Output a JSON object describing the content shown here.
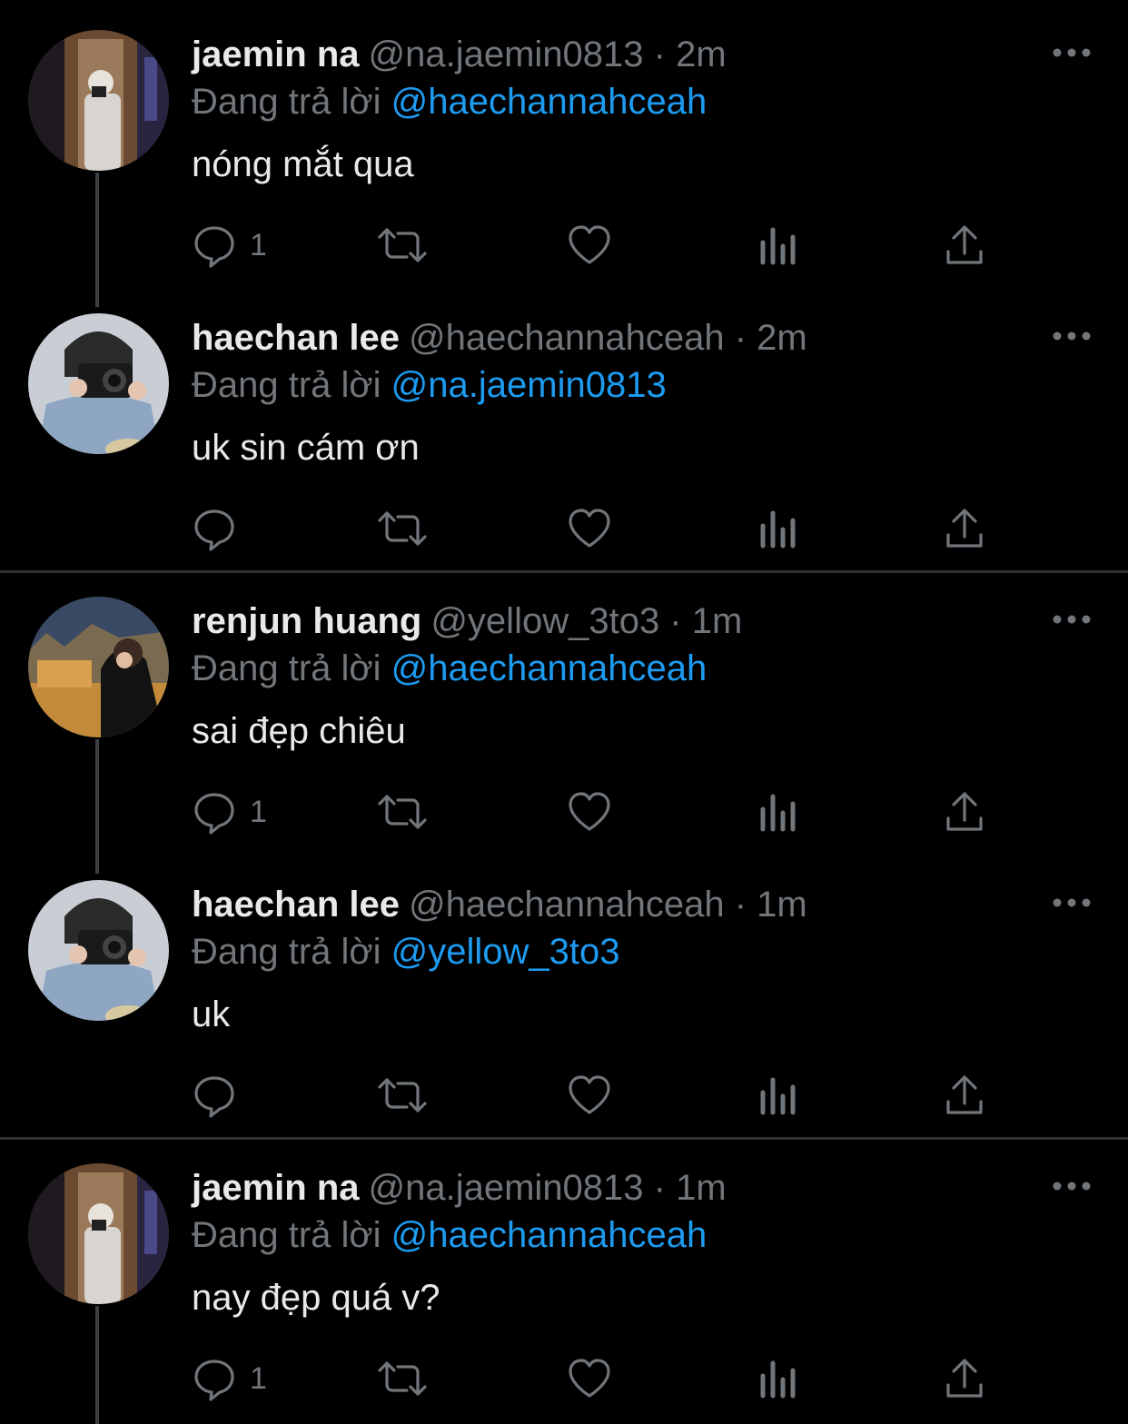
{
  "reply_prefix": "Đang trả lời",
  "colors": {
    "background": "#000000",
    "text": "#e7e9ea",
    "muted": "#71767b",
    "link": "#1d9bf0",
    "divider": "#2f3336"
  },
  "icons": {
    "reply": "speech-bubble-icon",
    "retweet": "retweet-arrows-icon",
    "like": "heart-icon",
    "views": "bar-chart-icon",
    "share": "share-upload-icon",
    "more": "more-dots-icon"
  },
  "tweets": [
    {
      "name": "jaemin na",
      "meta": "@na.jaemin0813 · 2m",
      "mention": "@haechannahceah",
      "text": "nóng mắt qua",
      "reply_count": "1"
    },
    {
      "name": "haechan lee",
      "meta": "@haechannahceah · 2m",
      "mention": "@na.jaemin0813",
      "text": "uk sin cám ơn",
      "reply_count": ""
    },
    {
      "name": "renjun huang",
      "meta": "@yellow_3to3 · 1m",
      "mention": "@haechannahceah",
      "text": "sai đẹp chiêu",
      "reply_count": "1"
    },
    {
      "name": "haechan lee",
      "meta": "@haechannahceah · 1m",
      "mention": "@yellow_3to3",
      "text": "uk",
      "reply_count": ""
    },
    {
      "name": "jaemin na",
      "meta": "@na.jaemin0813 · 1m",
      "mention": "@haechannahceah",
      "text": "nay đẹp quá v?",
      "reply_count": "1"
    }
  ]
}
